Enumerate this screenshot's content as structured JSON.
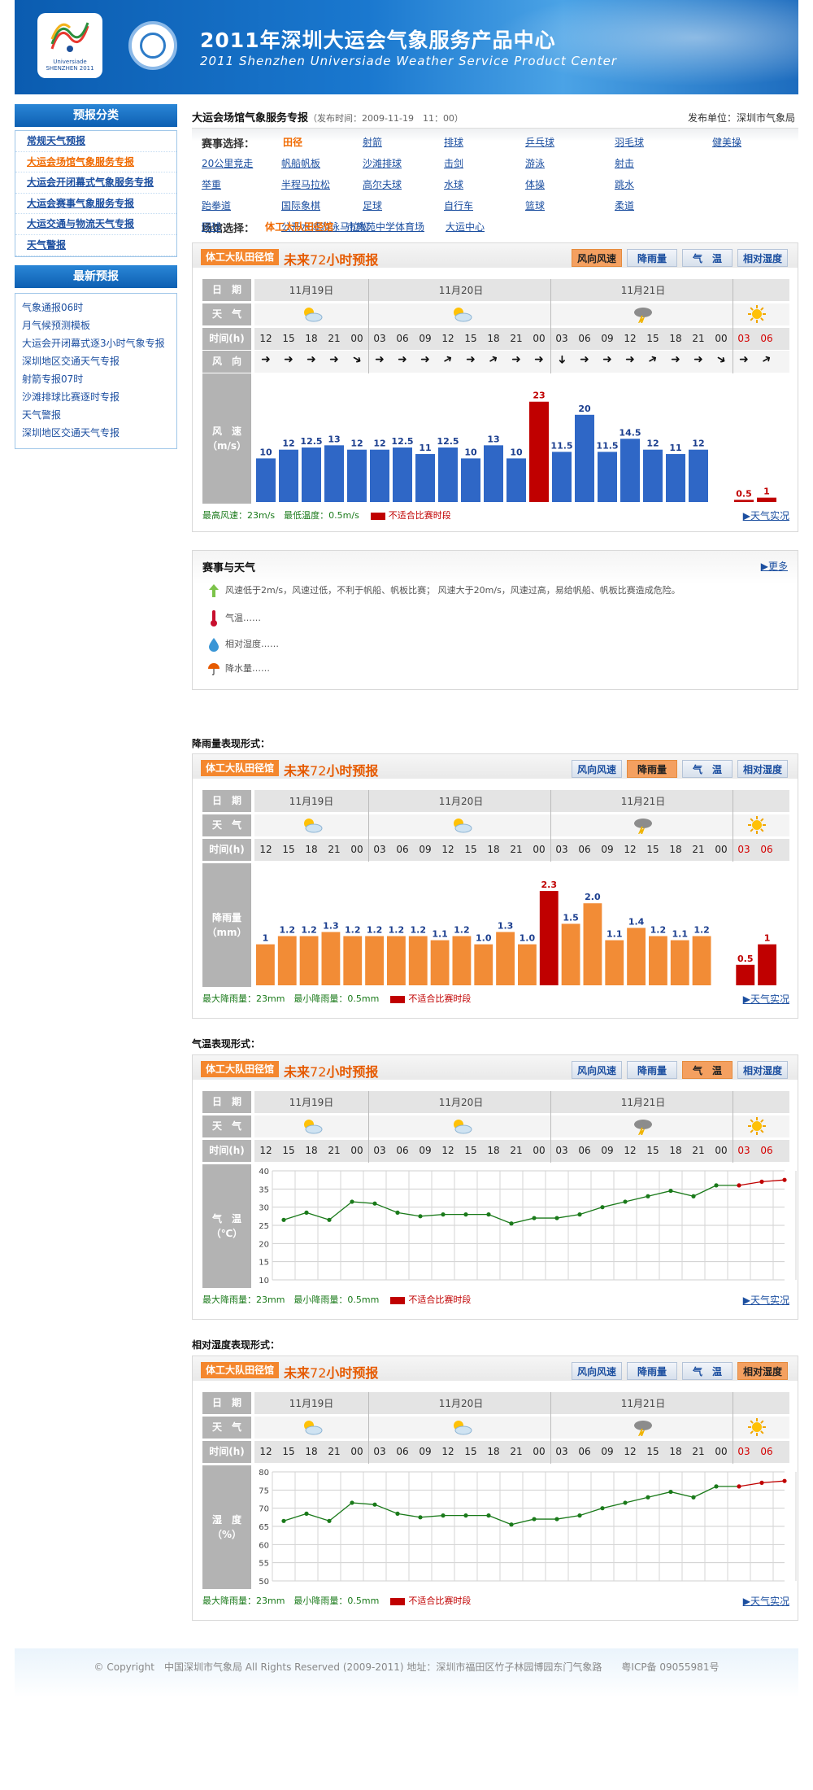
{
  "header": {
    "title": "2011年深圳大运会气象服务产品中心",
    "subtitle": "2011 Shenzhen Universiade Weather Service Product Center",
    "logo_text": "Universiade SHENZHEN 2011"
  },
  "sidebar": {
    "categories_title": "预报分类",
    "categories": [
      "常规天气预报",
      "大运会场馆气象服务专报",
      "大运会开闭幕式气象服务专报",
      "大运会赛事气象服务专报",
      "大运交通与物流天气专报",
      "天气警报"
    ],
    "active_category": 1,
    "latest_title": "最新预报",
    "latest": [
      "气象通报06时",
      "月气候预测模板",
      "大运会开闭幕式逐3小时气象专报",
      "深圳地区交通天气专报",
      "射箭专报07时",
      "沙滩排球比赛逐时专报",
      "天气警报",
      "深圳地区交通天气专报"
    ]
  },
  "main": {
    "title": "大运会场馆气象服务专报",
    "time_label": "（发布时间：2009-11-19　11：00）",
    "unit": "发布单位：深圳市气象局",
    "event_label": "赛事选择：",
    "venue_label": "场馆选择：",
    "events": [
      "田径",
      "射箭",
      "排球",
      "乒乓球",
      "羽毛球",
      "健美操",
      "20公里竞走",
      "帆船帆板",
      "沙滩排球",
      "击剑",
      "游泳",
      "射击",
      "举重",
      "半程马拉松",
      "高尔夫球",
      "水球",
      "体操",
      "跳水",
      "跆拳道",
      "国际象棋",
      "足球",
      "自行车",
      "篮球",
      "柔道",
      "网球",
      "公开水域游泳马拉松"
    ],
    "venues": [
      "体工大队田径馆",
      "市教苑中学体育场",
      "大运中心"
    ],
    "notes": {
      "title": "赛事与天气",
      "more": "更多",
      "wind": "风速低于2m/s，风速过低，不利于帆船、帆板比赛；  风速大于20m/s，风速过高，易给帆船、帆板比赛造成危险。",
      "temp": "气温……",
      "humidity": "相对湿度……",
      "rain": "降水量……"
    }
  },
  "forecast": {
    "venue": "体工大队田径馆",
    "title_a": "未来",
    "title_n": "72",
    "title_b": "小时预报",
    "tabs": [
      "风向风速",
      "降雨量",
      "气　温",
      "相对湿度"
    ],
    "row_labels": {
      "date": "日　期",
      "weather": "天　气",
      "time": "时间(h)",
      "wind_dir": "风　向"
    },
    "days": [
      "11月19日",
      "11月20日",
      "11月21日"
    ],
    "hours": [
      "12",
      "15",
      "18",
      "21",
      "00",
      "03",
      "06",
      "09",
      "12",
      "15",
      "18",
      "21",
      "00",
      "03",
      "06",
      "09",
      "12",
      "15",
      "18",
      "21",
      "00",
      "03",
      "06"
    ],
    "red_hours_from": 21,
    "weather_icons": [
      "partly-cloudy-icon",
      "partly-cloudy-icon",
      "thunderstorm-icon",
      "sunny-icon"
    ],
    "wind_dirs": [
      90,
      90,
      90,
      90,
      120,
      90,
      90,
      90,
      60,
      90,
      60,
      90,
      90,
      180,
      90,
      90,
      90,
      60,
      90,
      90,
      120,
      90,
      60
    ],
    "link": "天气实况",
    "unsuitable": "不适合比赛时段"
  },
  "sections": {
    "rain": "降雨量表现形式：",
    "temp": "气温表现形式：",
    "humidity": "相对湿度表现形式："
  },
  "panels": [
    {
      "active_tab": 0,
      "ylabel": "风　速\n（m/s）",
      "foot": "最高风速：23m/s　最低温度：0.5m/s"
    },
    {
      "active_tab": 1,
      "ylabel": "降雨量\n（mm）",
      "foot": "最大降雨量：23mm　最小降雨量：0.5mm"
    },
    {
      "active_tab": 2,
      "ylabel": "气　温\n（℃）",
      "foot": "最大降雨量：23mm　最小降雨量：0.5mm"
    },
    {
      "active_tab": 3,
      "ylabel": "湿　度\n（%）",
      "foot": "最大降雨量：23mm　最小降雨量：0.5mm"
    }
  ],
  "chart_data": [
    {
      "type": "bar",
      "title": "",
      "ylabel": "风速（m/s）",
      "categories": [
        "12",
        "15",
        "18",
        "21",
        "00",
        "03",
        "06",
        "09",
        "12",
        "15",
        "18",
        "21",
        "00",
        "03",
        "06",
        "09",
        "12",
        "15",
        "18",
        "21",
        "00",
        "03",
        "06"
      ],
      "values": [
        10,
        12,
        12.5,
        13,
        12,
        12,
        12.5,
        11,
        12.5,
        10,
        13,
        10,
        23,
        11.5,
        20,
        11.5,
        14.5,
        12,
        11,
        12,
        null,
        0.5,
        1
      ],
      "value_labels": [
        "10",
        "12",
        "12.5",
        "13",
        "12",
        "12",
        "12.5",
        "11",
        "12.5",
        "10",
        "13",
        "10",
        "23",
        "11.5",
        "20",
        "11.5",
        "14.5",
        "12",
        "11",
        "12",
        "",
        "0.5",
        "1"
      ],
      "highlight_index": 12,
      "color": "#2f67c6",
      "highlight_color": "#c00000",
      "ylim": [
        0,
        25
      ]
    },
    {
      "type": "bar",
      "title": "",
      "ylabel": "降雨量（mm）",
      "categories": [
        "12",
        "15",
        "18",
        "21",
        "00",
        "03",
        "06",
        "09",
        "12",
        "15",
        "18",
        "21",
        "00",
        "03",
        "06",
        "09",
        "12",
        "15",
        "18",
        "21",
        "00",
        "03",
        "06"
      ],
      "values": [
        1,
        1.2,
        1.2,
        1.3,
        1.2,
        1.2,
        1.2,
        1.2,
        1.1,
        1.2,
        1.0,
        1.3,
        1.0,
        2.3,
        1.5,
        2.0,
        1.1,
        1.4,
        1.2,
        1.1,
        1.2,
        null,
        0.5,
        1
      ],
      "value_labels": [
        "1",
        "1.2",
        "1.2",
        "1.3",
        "1.2",
        "1.2",
        "1.2",
        "1.2",
        "1.1",
        "1.2",
        "1.0",
        "1.3",
        "1.0",
        "2.3",
        "1.5",
        "2.0",
        "1.1",
        "1.4",
        "1.2",
        "1.1",
        "1.2",
        "",
        "0.5",
        "1"
      ],
      "highlight_index": 13,
      "color": "#f28c36",
      "highlight_color": "#c00000",
      "ylim": [
        0,
        2.5
      ]
    },
    {
      "type": "line",
      "title": "",
      "ylabel": "气温（℃）",
      "categories": [
        "12",
        "15",
        "18",
        "21",
        "00",
        "03",
        "06",
        "09",
        "12",
        "15",
        "18",
        "21",
        "00",
        "03",
        "06",
        "09",
        "12",
        "15",
        "18",
        "21",
        "00",
        "03",
        "06"
      ],
      "values": [
        26.5,
        28.5,
        26.5,
        31.5,
        31,
        28.5,
        27.5,
        28,
        28,
        28,
        25.5,
        27,
        27,
        28,
        30,
        31.5,
        33,
        34.5,
        33,
        36,
        36,
        37,
        37.5
      ],
      "red_from": 20,
      "ylim": [
        10,
        40
      ],
      "yticks": [
        10,
        15,
        20,
        25,
        30,
        35,
        40
      ]
    },
    {
      "type": "line",
      "title": "",
      "ylabel": "湿度（%）",
      "categories": [
        "12",
        "15",
        "18",
        "21",
        "00",
        "03",
        "06",
        "09",
        "12",
        "15",
        "18",
        "21",
        "00",
        "03",
        "06",
        "09",
        "12",
        "15",
        "18",
        "21",
        "00",
        "03",
        "06"
      ],
      "values": [
        66.5,
        68.5,
        66.5,
        71.5,
        71,
        68.5,
        67.5,
        68,
        68,
        68,
        65.5,
        67,
        67,
        68,
        70,
        71.5,
        73,
        74.5,
        73,
        76,
        76,
        77,
        77.5
      ],
      "red_from": 20,
      "ylim": [
        50,
        80
      ],
      "yticks": [
        50,
        55,
        60,
        65,
        70,
        75,
        80
      ]
    }
  ],
  "footer": "© Copyright　中国深圳市气象局  All Rights Reserved (2009-2011)  地址：深圳市福田区竹子林园博园东门气象路　　粤ICP备 09055981号"
}
